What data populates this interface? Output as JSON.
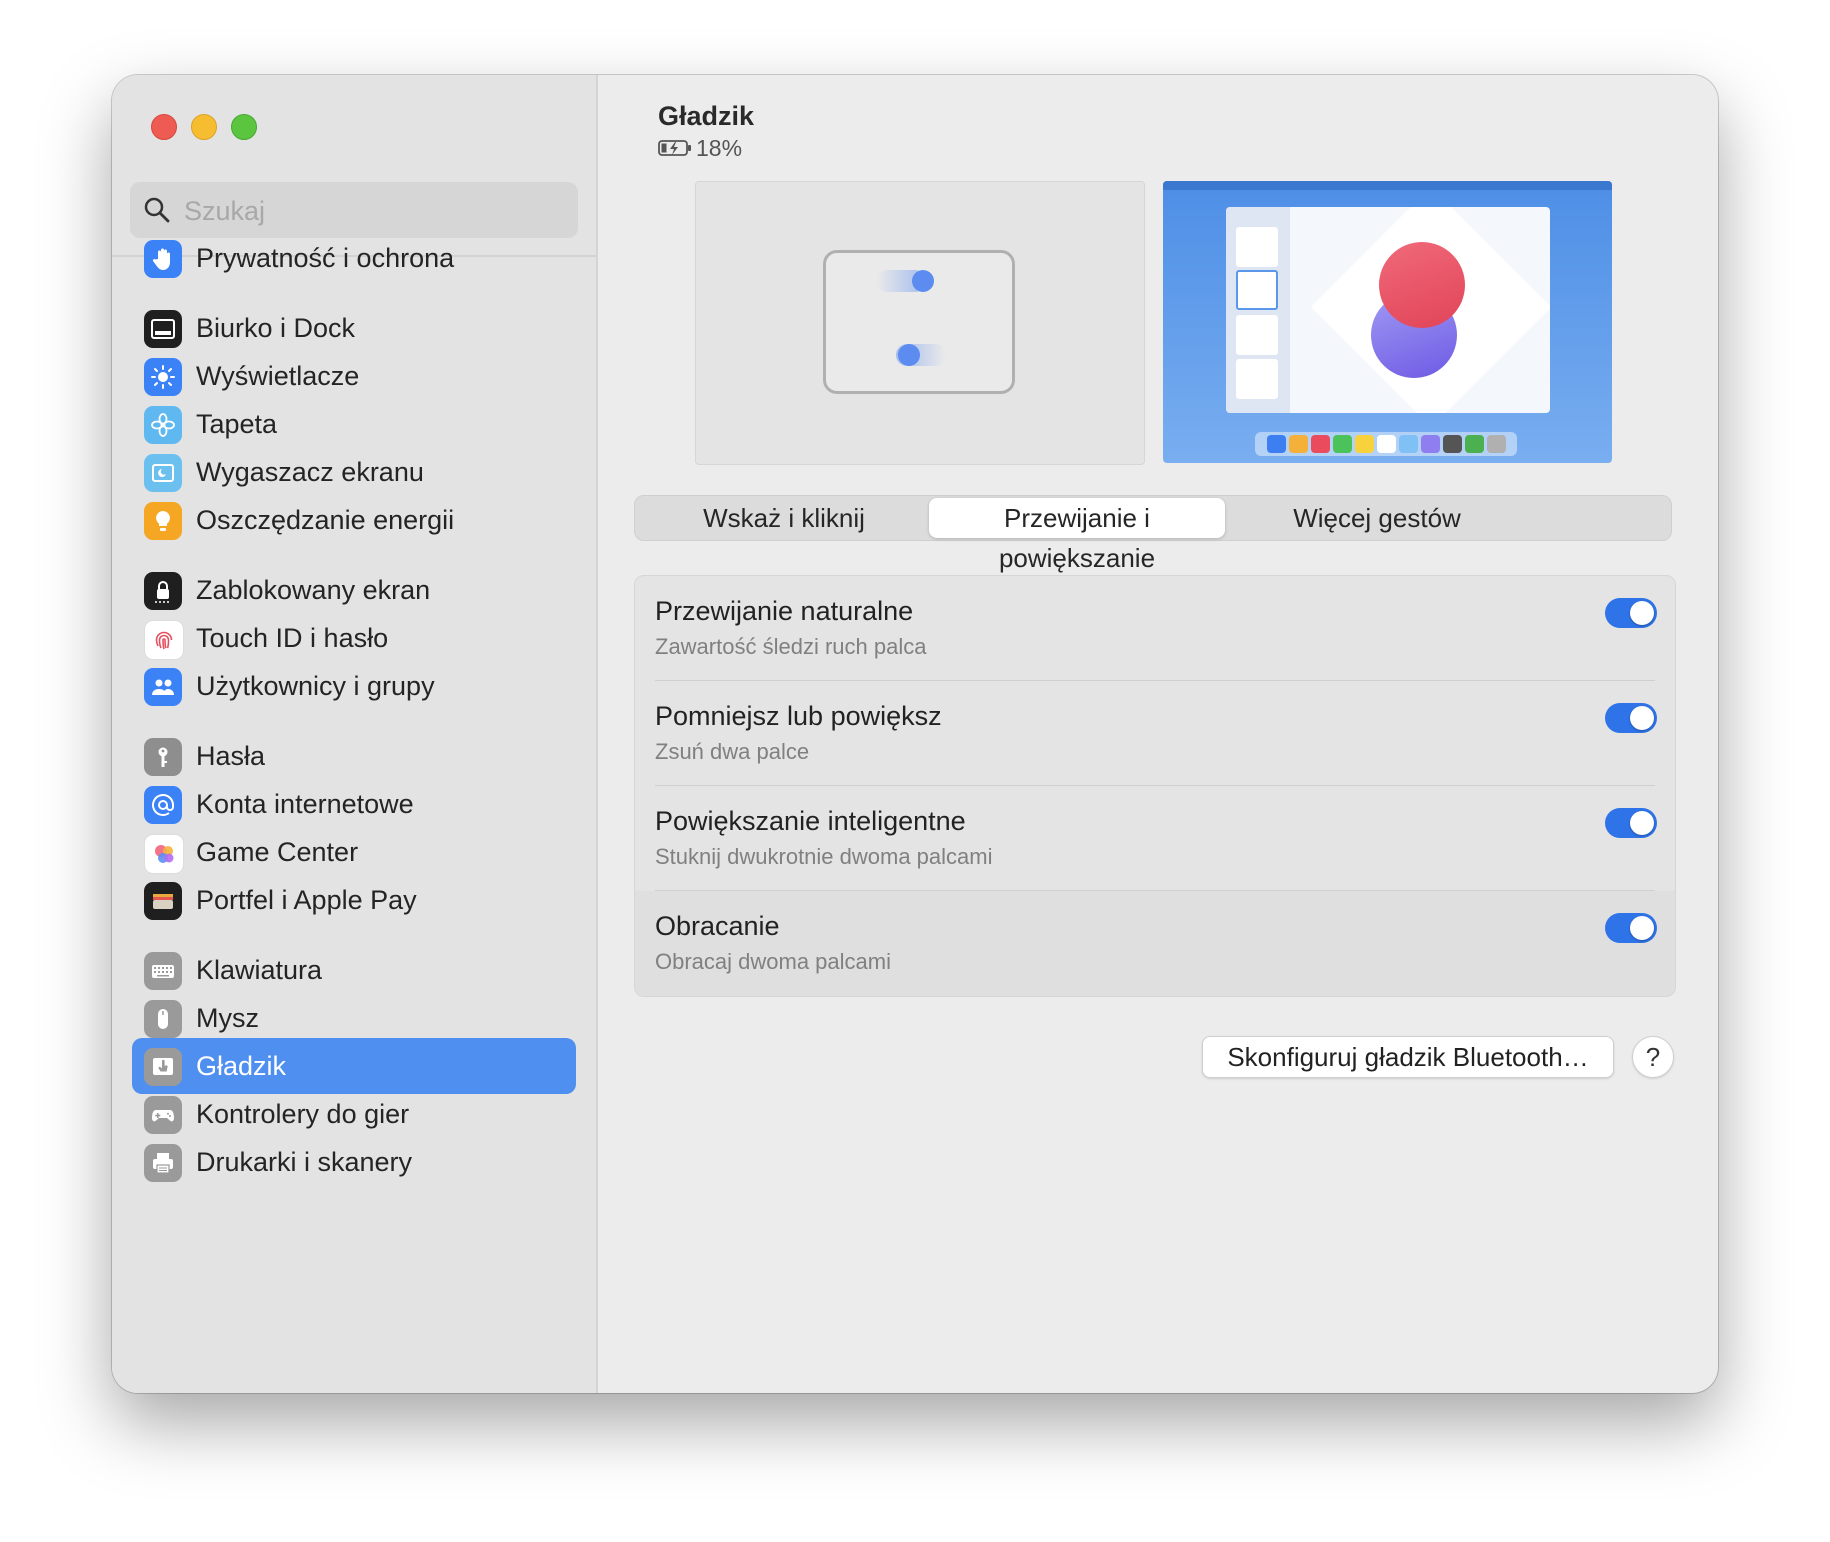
{
  "window": {
    "traffic_lights": [
      "close",
      "minimize",
      "zoom"
    ]
  },
  "sidebar": {
    "search": {
      "placeholder": "Szukaj",
      "value": ""
    },
    "items": [
      {
        "label": "Prywatność i ochrona",
        "icon": "hand-icon",
        "color": "#3b82f6"
      },
      {
        "label": "Biurko i Dock",
        "icon": "dock-icon",
        "color": "#1f1f1f"
      },
      {
        "label": "Wyświetlacze",
        "icon": "sun-icon",
        "color": "#3b82f6"
      },
      {
        "label": "Tapeta",
        "icon": "flower-icon",
        "color": "#60b8f0"
      },
      {
        "label": "Wygaszacz ekranu",
        "icon": "screensaver-icon",
        "color": "#6cc0f0"
      },
      {
        "label": "Oszczędzanie energii",
        "icon": "bulb-icon",
        "color": "#f5a623"
      },
      {
        "label": "Zablokowany ekran",
        "icon": "lock-icon",
        "color": "#1f1f1f"
      },
      {
        "label": "Touch ID i hasło",
        "icon": "fingerprint-icon",
        "color": "#ffffff"
      },
      {
        "label": "Użytkownicy i grupy",
        "icon": "users-icon",
        "color": "#3b82f6"
      },
      {
        "label": "Hasła",
        "icon": "key-icon",
        "color": "#8e8e8e"
      },
      {
        "label": "Konta internetowe",
        "icon": "at-icon",
        "color": "#3b82f6"
      },
      {
        "label": "Game Center",
        "icon": "game-center-icon",
        "color": "#ffffff"
      },
      {
        "label": "Portfel i Apple Pay",
        "icon": "wallet-icon",
        "color": "#1f1f1f"
      },
      {
        "label": "Klawiatura",
        "icon": "keyboard-icon",
        "color": "#9a9a9a"
      },
      {
        "label": "Mysz",
        "icon": "mouse-icon",
        "color": "#9a9a9a"
      },
      {
        "label": "Gładzik",
        "icon": "trackpad-icon",
        "color": "#9a9a9a",
        "selected": true
      },
      {
        "label": "Kontrolery do gier",
        "icon": "gamepad-icon",
        "color": "#9a9a9a"
      },
      {
        "label": "Drukarki i skanery",
        "icon": "printer-icon",
        "color": "#9a9a9a"
      }
    ]
  },
  "main": {
    "device_title": "Gładzik",
    "battery_percent": "18%",
    "tabs": [
      {
        "label": "Wskaż i kliknij",
        "active": false
      },
      {
        "label": "Przewijanie i powiększanie",
        "active": true
      },
      {
        "label": "Więcej gestów",
        "active": false
      }
    ],
    "settings": [
      {
        "title": "Przewijanie naturalne",
        "subtitle": "Zawartość śledzi ruch palca",
        "on": true
      },
      {
        "title": "Pomniejsz lub powiększ",
        "subtitle": "Zsuń dwa palce",
        "on": true
      },
      {
        "title": "Powiększanie inteligentne",
        "subtitle": "Stuknij dwukrotnie dwoma palcami",
        "on": true
      },
      {
        "title": "Obracanie",
        "subtitle": "Obracaj dwoma palcami",
        "on": true
      }
    ],
    "bluetooth_button": "Skonfiguruj gładzik Bluetooth…",
    "help_button": "?"
  },
  "colors": {
    "accent": "#2f73e8",
    "selection": "#4f8ff0"
  }
}
